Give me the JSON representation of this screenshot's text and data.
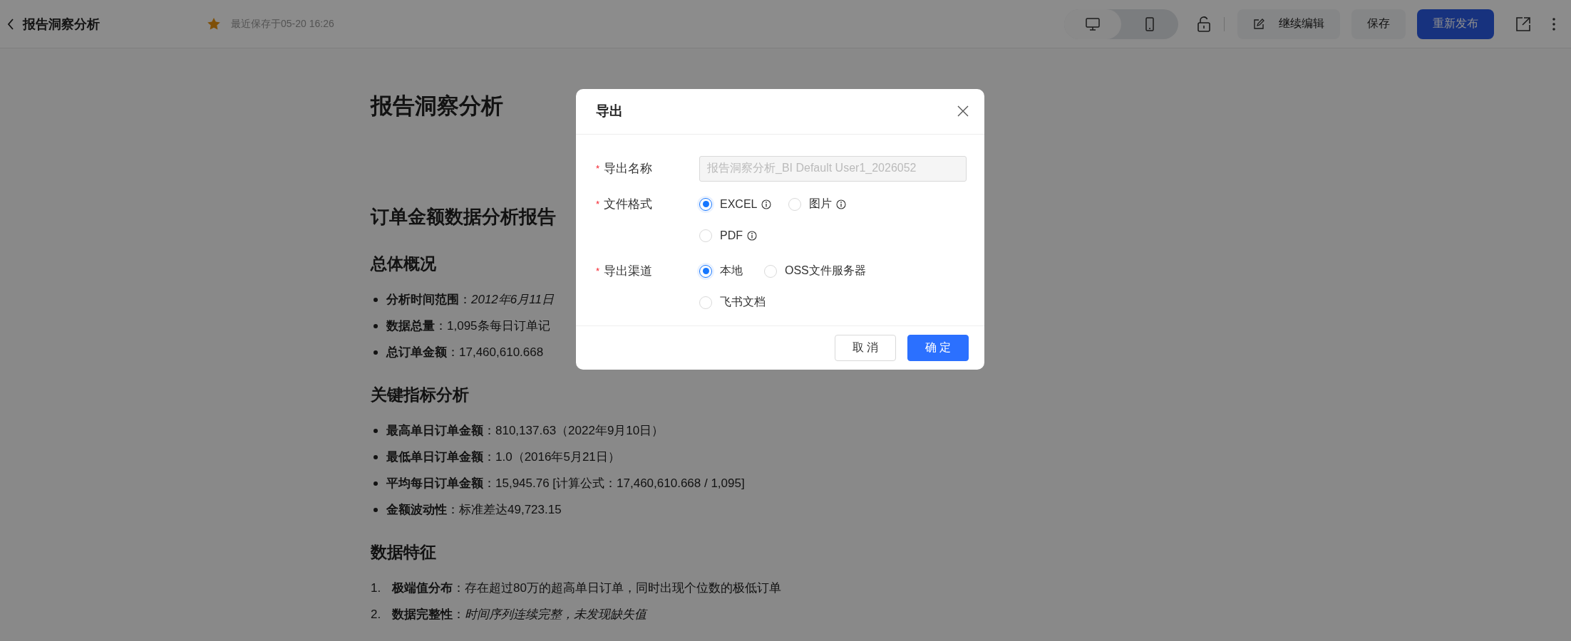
{
  "header": {
    "title": "报告洞察分析",
    "favorited": true,
    "saved_note": "最近保存于05-20 16:26",
    "devices": [
      {
        "kind": "desktop",
        "selected": true
      },
      {
        "kind": "mobile",
        "selected": false
      }
    ],
    "buttons": [
      {
        "kind": "edit",
        "label": "继续编辑"
      },
      {
        "kind": "plain",
        "label": "保存"
      },
      {
        "kind": "primary",
        "label": "重新发布"
      }
    ]
  },
  "document": {
    "title": "报告洞察分析",
    "blocks": [
      {
        "kind": "h2",
        "text": "订单金额数据分析报告"
      },
      {
        "kind": "h3",
        "text": "总体概况"
      },
      {
        "kind": "bullets",
        "items": [
          "**分析时间范围**：*2012年6月11日*",
          "**数据总量**：1,095条每日订单记",
          "**总订单金额**：17,460,610.668"
        ]
      },
      {
        "kind": "h3",
        "text": "关键指标分析"
      },
      {
        "kind": "bullets",
        "items": [
          "**最高单日订单金额**：810,137.63（2022年9月10日）",
          "**最低单日订单金额**：1.0（2016年5月21日）",
          "**平均每日订单金额**：15,945.76 [计算公式：17,460,610.668 / 1,095]",
          "**金额波动性**：标准差达49,723.15"
        ]
      },
      {
        "kind": "h3",
        "text": "数据特征"
      },
      {
        "kind": "numbered",
        "items": [
          {
            "number": "1.",
            "text": "**极端值分布**：存在超过80万的超高单日订单，同时出现个位数的极低订单"
          },
          {
            "number": "2.",
            "text": "**数据完整性**：*时间序列连续完整，未发现缺失值*"
          }
        ]
      }
    ]
  },
  "dialog": {
    "title": "导出",
    "fields": [
      {
        "kind": "text",
        "label": "导出名称",
        "required_mark": "*",
        "value": "报告洞察分析_BI Default User1_2026052",
        "disabled": true
      },
      {
        "kind": "radio",
        "label": "文件格式",
        "required_mark": "*",
        "options": [
          {
            "label": "EXCEL",
            "info": true,
            "selected": true
          },
          {
            "label": "图片",
            "info": true,
            "selected": false
          },
          {
            "label": "PDF",
            "info": true,
            "selected": false
          }
        ]
      },
      {
        "kind": "radio",
        "label": "导出渠道",
        "required_mark": "*",
        "options": [
          {
            "label": "本地",
            "selected": true
          },
          {
            "label": "OSS文件服务器",
            "selected": false
          },
          {
            "label": "飞书文档",
            "selected": false
          }
        ]
      }
    ],
    "buttons": [
      {
        "kind": "default",
        "label": "取 消"
      },
      {
        "kind": "primary",
        "label": "确 定"
      }
    ]
  }
}
